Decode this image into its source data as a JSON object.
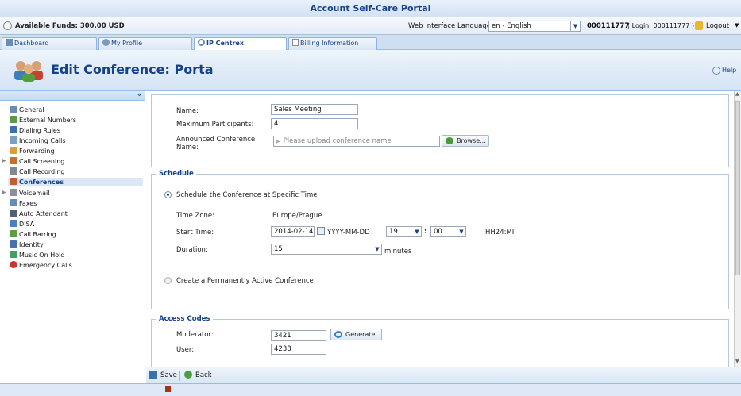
{
  "portal_title": "Account Self-Care Portal",
  "infobar": {
    "funds": "Available Funds: 300.00 USD",
    "language_label": "Web Interface Language:",
    "language_value": "en - English",
    "account_number": "000111777",
    "login_text": "( Login: 000111777 )",
    "logout": "Logout"
  },
  "tabs": [
    {
      "label": "Dashboard"
    },
    {
      "label": "My Profile"
    },
    {
      "label": "IP Centrex"
    },
    {
      "label": "Billing Information"
    }
  ],
  "page_title": "Edit Conference: Porta",
  "help": "Help",
  "sidebar": {
    "collapse": "«",
    "items": [
      {
        "label": "General",
        "color": "#6a8db5"
      },
      {
        "label": "External Numbers",
        "color": "#5a9a4a"
      },
      {
        "label": "Dialing Rules",
        "color": "#3a6fb0"
      },
      {
        "label": "Incoming Calls",
        "color": "#7aa0c8"
      },
      {
        "label": "Forwarding",
        "color": "#d8a030"
      },
      {
        "label": "Call Screening",
        "color": "#c07030"
      },
      {
        "label": "Call Recording",
        "color": "#808890"
      },
      {
        "label": "Conferences",
        "color": "#c85a30"
      },
      {
        "label": "Voicemail",
        "color": "#8890a0"
      },
      {
        "label": "Faxes",
        "color": "#6a8db5"
      },
      {
        "label": "Auto Attendant",
        "color": "#506070"
      },
      {
        "label": "DISA",
        "color": "#4a80c0"
      },
      {
        "label": "Call Barring",
        "color": "#5aa040"
      },
      {
        "label": "Identity",
        "color": "#4a70b0"
      },
      {
        "label": "Music On Hold",
        "color": "#40a060"
      },
      {
        "label": "Emergency Calls",
        "color": "#d03030"
      }
    ]
  },
  "form": {
    "name_label": "Name:",
    "name_value": "Sales Meeting",
    "max_label": "Maximum Participants:",
    "max_value": "4",
    "announced_label_1": "Announced Conference",
    "announced_label_2": "Name:",
    "upload_placeholder": "Please upload conference name",
    "browse": "Browse..."
  },
  "schedule": {
    "legend": "Schedule",
    "option_specific": "Schedule the Conference at Specific Time",
    "tz_label": "Time Zone:",
    "tz_value": "Europe/Prague",
    "start_label": "Start Time:",
    "date_value": "2014-02-14",
    "date_format": "YYYY-MM-DD",
    "hour_value": "19",
    "minute_value": "00",
    "time_colon": ":",
    "time_format": "HH24:MI",
    "duration_label": "Duration:",
    "duration_value": "15",
    "duration_unit": "minutes",
    "option_permanent": "Create a Permanently Active Conference"
  },
  "access": {
    "legend": "Access Codes",
    "moderator_label": "Moderator:",
    "moderator_value": "3421",
    "generate": "Generate",
    "user_label": "User:",
    "user_value": "4238"
  },
  "footer": {
    "save": "Save",
    "back": "Back"
  }
}
